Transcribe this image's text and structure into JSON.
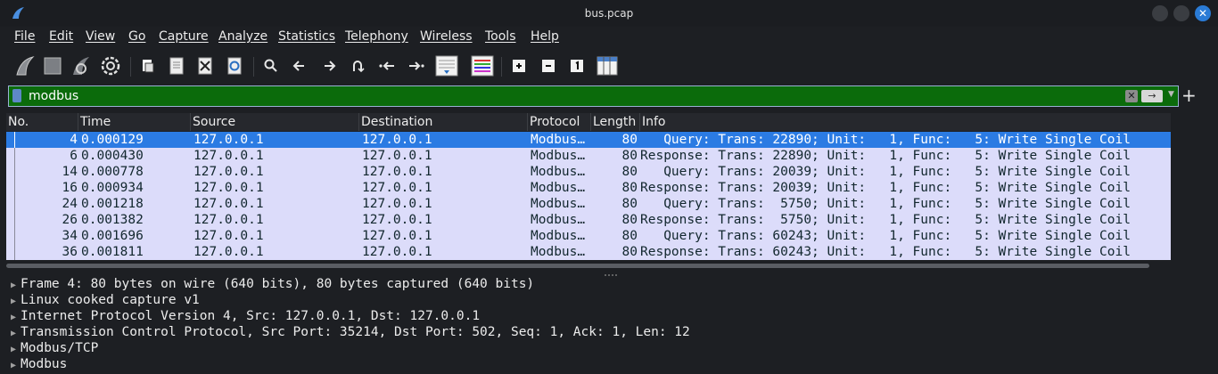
{
  "window": {
    "title": "bus.pcap",
    "close_glyph": "✕"
  },
  "menu": [
    "File",
    "Edit",
    "View",
    "Go",
    "Capture",
    "Analyze",
    "Statistics",
    "Telephony",
    "Wireless",
    "Tools",
    "Help"
  ],
  "toolbar": {
    "icons": [
      "start-capture-icon",
      "stop-capture-icon",
      "restart-capture-icon",
      "capture-options-icon",
      "open-file-icon",
      "save-file-icon",
      "close-file-icon",
      "reload-file-icon",
      "find-packet-icon",
      "go-back-icon",
      "go-forward-icon",
      "go-to-packet-icon",
      "first-packet-icon",
      "last-packet-icon",
      "autoscroll-icon",
      "colorize-icon",
      "zoom-in-icon",
      "zoom-out-icon",
      "normal-size-icon",
      "resize-columns-icon"
    ]
  },
  "filter": {
    "value": "modbus",
    "clear_glyph": "✕",
    "apply_glyph": "→",
    "dropdown_glyph": "▼",
    "add_glyph": "+"
  },
  "columns": {
    "no": "No.",
    "time": "Time",
    "source": "Source",
    "destination": "Destination",
    "protocol": "Protocol",
    "length": "Length",
    "info": "Info"
  },
  "packets": [
    {
      "no": "4",
      "time": "0.000129",
      "source": "127.0.0.1",
      "destination": "127.0.0.1",
      "protocol": "Modbus…",
      "length": "80",
      "info": "   Query: Trans: 22890; Unit:   1, Func:   5: Write Single Coil",
      "selected": true
    },
    {
      "no": "6",
      "time": "0.000430",
      "source": "127.0.0.1",
      "destination": "127.0.0.1",
      "protocol": "Modbus…",
      "length": "80",
      "info": "Response: Trans: 22890; Unit:   1, Func:   5: Write Single Coil",
      "selected": false
    },
    {
      "no": "14",
      "time": "0.000778",
      "source": "127.0.0.1",
      "destination": "127.0.0.1",
      "protocol": "Modbus…",
      "length": "80",
      "info": "   Query: Trans: 20039; Unit:   1, Func:   5: Write Single Coil",
      "selected": false
    },
    {
      "no": "16",
      "time": "0.000934",
      "source": "127.0.0.1",
      "destination": "127.0.0.1",
      "protocol": "Modbus…",
      "length": "80",
      "info": "Response: Trans: 20039; Unit:   1, Func:   5: Write Single Coil",
      "selected": false
    },
    {
      "no": "24",
      "time": "0.001218",
      "source": "127.0.0.1",
      "destination": "127.0.0.1",
      "protocol": "Modbus…",
      "length": "80",
      "info": "   Query: Trans:  5750; Unit:   1, Func:   5: Write Single Coil",
      "selected": false
    },
    {
      "no": "26",
      "time": "0.001382",
      "source": "127.0.0.1",
      "destination": "127.0.0.1",
      "protocol": "Modbus…",
      "length": "80",
      "info": "Response: Trans:  5750; Unit:   1, Func:   5: Write Single Coil",
      "selected": false
    },
    {
      "no": "34",
      "time": "0.001696",
      "source": "127.0.0.1",
      "destination": "127.0.0.1",
      "protocol": "Modbus…",
      "length": "80",
      "info": "   Query: Trans: 60243; Unit:   1, Func:   5: Write Single Coil",
      "selected": false
    },
    {
      "no": "36",
      "time": "0.001811",
      "source": "127.0.0.1",
      "destination": "127.0.0.1",
      "protocol": "Modbus…",
      "length": "80",
      "info": "Response: Trans: 60243; Unit:   1, Func:   5: Write Single Coil",
      "selected": false
    }
  ],
  "details": [
    "Frame 4: 80 bytes on wire (640 bits), 80 bytes captured (640 bits)",
    "Linux cooked capture v1",
    "Internet Protocol Version 4, Src: 127.0.0.1, Dst: 127.0.0.1",
    "Transmission Control Protocol, Src Port: 35214, Dst Port: 502, Seq: 1, Ack: 1, Len: 12",
    "Modbus/TCP",
    "Modbus"
  ],
  "colors": {
    "filter_bg": "#0b6b0b",
    "row_bg": "#dcdcfa",
    "selected_bg": "#2b7be3",
    "accent": "#2a7bd6"
  }
}
